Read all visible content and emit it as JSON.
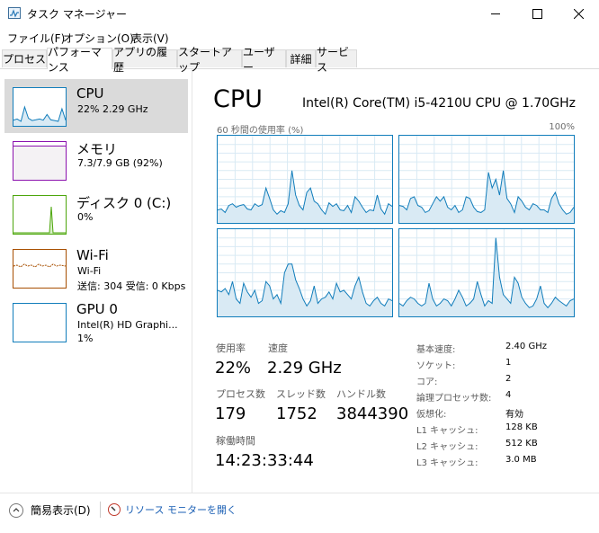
{
  "window": {
    "title": "タスク マネージャー"
  },
  "menu": [
    "ファイル(F)",
    "オプション(O)",
    "表示(V)"
  ],
  "tabs": [
    "プロセス",
    "パフォーマンス",
    "アプリの履歴",
    "スタートアップ",
    "ユーザー",
    "詳細",
    "サービス"
  ],
  "active_tab": "パフォーマンス",
  "sidebar": [
    {
      "name": "CPU",
      "sub1": "22%  2.29 GHz",
      "sub2": "",
      "color": "#117dbb",
      "selected": true
    },
    {
      "name": "メモリ",
      "sub1": "7.3/7.9 GB (92%)",
      "sub2": "",
      "color": "#8b12ae",
      "selected": false
    },
    {
      "name": "ディスク 0 (C:)",
      "sub1": "0%",
      "sub2": "",
      "color": "#4da60c",
      "selected": false
    },
    {
      "name": "Wi-Fi",
      "sub1": "Wi-Fi",
      "sub2": "送信: 304  受信: 0 Kbps",
      "color": "#a74f01",
      "selected": false
    },
    {
      "name": "GPU 0",
      "sub1": "Intel(R) HD Graphi...",
      "sub2": "1%",
      "color": "#117dbb",
      "selected": false
    }
  ],
  "cpu": {
    "title": "CPU",
    "model": "Intel(R) Core(TM) i5-4210U CPU @ 1.70GHz",
    "graph_label": "60 秒間の使用率 (%)",
    "graph_max_label": "100%",
    "graph_color": "#117dbb",
    "graph_fill": "#d9eaf4",
    "stats": {
      "usage_label": "使用率",
      "usage": "22%",
      "speed_label": "速度",
      "speed": "2.29 GHz",
      "processes_label": "プロセス数",
      "processes": "179",
      "threads_label": "スレッド数",
      "threads": "1752",
      "handles_label": "ハンドル数",
      "handles": "3844390",
      "uptime_label": "稼働時間",
      "uptime": "14:23:33:44"
    },
    "specs": [
      {
        "label": "基本速度:",
        "value": "2.40 GHz"
      },
      {
        "label": "ソケット:",
        "value": "1"
      },
      {
        "label": "コア:",
        "value": "2"
      },
      {
        "label": "論理プロセッサ数:",
        "value": "4"
      },
      {
        "label": "仮想化:",
        "value": "有効"
      },
      {
        "label": "L1 キャッシュ:",
        "value": "128 KB"
      },
      {
        "label": "L2 キャッシュ:",
        "value": "512 KB"
      },
      {
        "label": "L3 キャッシュ:",
        "value": "3.0 MB"
      }
    ],
    "core_history": [
      [
        15,
        16,
        12,
        20,
        22,
        18,
        20,
        21,
        16,
        15,
        22,
        19,
        21,
        40,
        28,
        15,
        10,
        14,
        12,
        22,
        60,
        32,
        20,
        15,
        35,
        40,
        25,
        22,
        15,
        10,
        23,
        19,
        22,
        15,
        14,
        20,
        12,
        30,
        25,
        18,
        12,
        15,
        14,
        32,
        16,
        10,
        22,
        19
      ],
      [
        20,
        19,
        15,
        28,
        30,
        20,
        18,
        12,
        14,
        22,
        30,
        25,
        30,
        18,
        15,
        20,
        12,
        15,
        30,
        28,
        18,
        13,
        12,
        15,
        58,
        40,
        50,
        32,
        60,
        28,
        22,
        12,
        30,
        25,
        18,
        15,
        22,
        20,
        15,
        15,
        12,
        28,
        35,
        22,
        15,
        10,
        12,
        18
      ],
      [
        30,
        28,
        32,
        25,
        40,
        20,
        15,
        38,
        28,
        22,
        30,
        15,
        18,
        40,
        35,
        20,
        25,
        15,
        50,
        60,
        60,
        42,
        32,
        20,
        12,
        18,
        35,
        15,
        20,
        22,
        28,
        20,
        38,
        28,
        30,
        25,
        20,
        35,
        45,
        28,
        15,
        12,
        18,
        22,
        15,
        12,
        20,
        18
      ],
      [
        15,
        12,
        18,
        22,
        20,
        15,
        12,
        15,
        38,
        20,
        12,
        15,
        20,
        18,
        12,
        20,
        30,
        22,
        12,
        15,
        20,
        40,
        25,
        12,
        18,
        15,
        90,
        45,
        25,
        20,
        15,
        45,
        38,
        22,
        15,
        10,
        12,
        20,
        35,
        15,
        10,
        15,
        22,
        18,
        15,
        12,
        18,
        20
      ]
    ],
    "thumb_history": [
      15,
      18,
      12,
      50,
      20,
      14,
      16,
      18,
      15,
      30,
      16,
      14,
      12,
      45,
      15
    ]
  },
  "footer": {
    "fewer_details": "簡易表示(D)",
    "resource_monitor": "リソース モニターを開く"
  }
}
